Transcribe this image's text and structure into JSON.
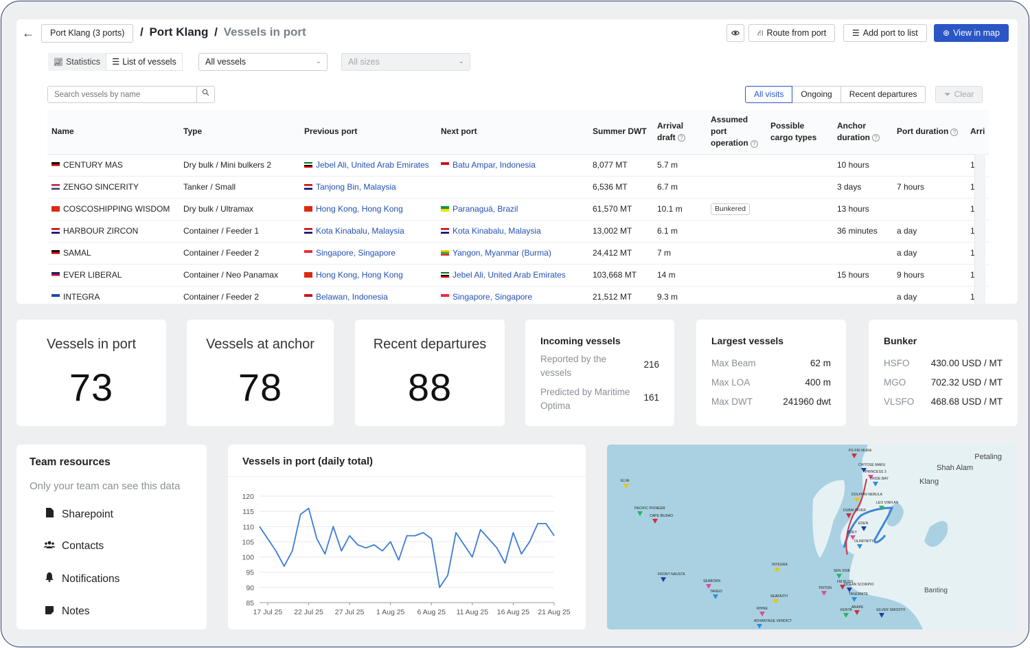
{
  "header": {
    "port_select": "Port Klang (3 ports)",
    "crumb_sep": "/",
    "port_name": "Port Klang",
    "page_name": "Vessels in port",
    "route_btn": "Route from port",
    "add_btn": "Add port to list",
    "map_btn": "View in map"
  },
  "controls": {
    "tab_stats": "Statistics",
    "tab_list": "List of vessels",
    "vessels_filter": "All vessels",
    "sizes_filter": "All sizes",
    "search_placeholder": "Search vessels by name",
    "visit_tabs": [
      "All visits",
      "Ongoing",
      "Recent departures"
    ],
    "clear": "Clear"
  },
  "table": {
    "headers": {
      "name": "Name",
      "type": "Type",
      "prev": "Previous port",
      "next": "Next port",
      "dwt": "Summer DWT",
      "arrival_draft": "Arrival draft",
      "assumed": "Assumed port operation",
      "cargo": "Possible cargo types",
      "anchor": "Anchor duration",
      "port_duration": "Port duration",
      "arrival": "Arri"
    },
    "rows": [
      {
        "name": "CENTURY MAS",
        "type": "Dry bulk / Mini bulkers 2",
        "prev": "Jebel Ali, United Arab Emirates",
        "next": "Batu Ampar, Indonesia",
        "dwt": "8,077 MT",
        "draft": "5.7 m",
        "op": "",
        "cargo": "",
        "anchor": "10 hours",
        "port": "",
        "arr": "1"
      },
      {
        "name": "ZENGO SINCERITY",
        "type": "Tanker / Small",
        "prev": "Tanjong Bin, Malaysia",
        "next": "",
        "dwt": "6,536 MT",
        "draft": "6.7 m",
        "op": "",
        "cargo": "",
        "anchor": "3 days",
        "port": "7 hours",
        "arr": "1"
      },
      {
        "name": "COSCOSHIPPING WISDOM",
        "type": "Dry bulk / Ultramax",
        "prev": "Hong Kong, Hong Kong",
        "next": "Paranaguá, Brazil",
        "dwt": "61,570 MT",
        "draft": "10.1 m",
        "op": "Bunkered",
        "cargo": "",
        "anchor": "13 hours",
        "port": "",
        "arr": "1"
      },
      {
        "name": "HARBOUR ZIRCON",
        "type": "Container / Feeder 1",
        "prev": "Kota Kinabalu, Malaysia",
        "next": "Kota Kinabalu, Malaysia",
        "dwt": "13,002 MT",
        "draft": "6.1 m",
        "op": "",
        "cargo": "",
        "anchor": "36 minutes",
        "port": "a day",
        "arr": "1"
      },
      {
        "name": "SAMAL",
        "type": "Container / Feeder 2",
        "prev": "Singapore, Singapore",
        "next": "Yangon, Myanmar (Burma)",
        "dwt": "24,412 MT",
        "draft": "7 m",
        "op": "",
        "cargo": "",
        "anchor": "",
        "port": "a day",
        "arr": "1"
      },
      {
        "name": "EVER LIBERAL",
        "type": "Container / Neo Panamax",
        "prev": "Hong Kong, Hong Kong",
        "next": "Jebel Ali, United Arab Emirates",
        "dwt": "103,668 MT",
        "draft": "14 m",
        "op": "",
        "cargo": "",
        "anchor": "15 hours",
        "port": "9 hours",
        "arr": "1"
      },
      {
        "name": "INTEGRA",
        "type": "Container / Feeder 2",
        "prev": "Belawan, Indonesia",
        "next": "Singapore, Singapore",
        "dwt": "21,512 MT",
        "draft": "9.3 m",
        "op": "",
        "cargo": "",
        "anchor": "",
        "port": "a day",
        "arr": "1"
      }
    ]
  },
  "stats": {
    "in_port": {
      "label": "Vessels in port",
      "value": "73"
    },
    "anchor": {
      "label": "Vessels at anchor",
      "value": "78"
    },
    "departures": {
      "label": "Recent departures",
      "value": "88"
    },
    "incoming": {
      "title": "Incoming vessels",
      "reported_label": "Reported by the vessels",
      "reported": "216",
      "predicted_label": "Predicted by Maritime Optima",
      "predicted": "161"
    },
    "largest": {
      "title": "Largest vessels",
      "beam_label": "Max Beam",
      "beam": "62 m",
      "loa_label": "Max LOA",
      "loa": "400 m",
      "dwt_label": "Max DWT",
      "dwt": "241960 dwt"
    },
    "bunker": {
      "title": "Bunker",
      "hsfo_label": "HSFO",
      "hsfo": "430.00 USD / MT",
      "mgo_label": "MGO",
      "mgo": "702.32 USD / MT",
      "vlsfo_label": "VLSFO",
      "vlsfo": "468.68 USD / MT"
    }
  },
  "team": {
    "title": "Team resources",
    "subtitle": "Only your team can see this data",
    "items": [
      "Sharepoint",
      "Contacts",
      "Notifications",
      "Notes"
    ]
  },
  "chart_data": {
    "type": "line",
    "title": "Vessels in port (daily total)",
    "x": [
      "16 Jul",
      "17 Jul",
      "18 Jul",
      "19 Jul",
      "20 Jul",
      "21 Jul",
      "22 Jul",
      "23 Jul",
      "24 Jul",
      "25 Jul",
      "26 Jul",
      "27 Jul",
      "28 Jul",
      "29 Jul",
      "30 Jul",
      "31 Jul",
      "1 Aug",
      "2 Aug",
      "3 Aug",
      "4 Aug",
      "5 Aug",
      "6 Aug",
      "7 Aug",
      "8 Aug",
      "9 Aug",
      "10 Aug",
      "11 Aug",
      "12 Aug",
      "13 Aug",
      "14 Aug",
      "15 Aug",
      "16 Aug",
      "17 Aug",
      "18 Aug",
      "19 Aug",
      "20 Aug",
      "21 Aug",
      "22 Aug"
    ],
    "values": [
      110,
      106,
      102,
      97,
      102,
      114,
      116,
      106,
      101,
      110,
      102,
      107,
      104,
      103,
      104,
      102,
      105,
      99,
      107,
      107,
      108,
      106,
      90,
      94,
      108,
      104,
      100,
      109,
      106,
      103,
      98,
      108,
      101,
      105,
      111,
      111,
      107
    ],
    "tick_labels": [
      "17 Jul 25",
      "22 Jul 25",
      "27 Jul 25",
      "1 Aug 25",
      "6 Aug 25",
      "11 Aug 25",
      "16 Aug 25",
      "21 Aug 25"
    ],
    "yticks": [
      85,
      90,
      95,
      100,
      105,
      110,
      115,
      120
    ],
    "ylim": [
      85,
      120
    ],
    "color": "#3a7bd5"
  },
  "map": {
    "places": [
      "Petaling",
      "Shah Alam",
      "Klang",
      "Banting"
    ],
    "vessel_labels": [
      "PS FRI MURA",
      "CHITOSE MARU",
      "PRINCESS 3",
      "TRIDE BAY",
      "DOLPHIN NEBULA",
      "LEO VINH AN",
      "DUBAI DIVER",
      "EDEN",
      "ZOEY",
      "OLINFINITY",
      "ELVA",
      "PACIFIC PIONEER",
      "CAPE BILBAO",
      "FRONT NAUSTA",
      "SEABORN",
      "TANGO",
      "INTEGRA",
      "SEN 2008",
      "FM BLISS",
      "OCEAN SCORPIO",
      "TRITON",
      "TANZANITE",
      "SEAFAITH",
      "KENTA",
      "ARAPE",
      "SILVER SMOOTH",
      "RHINE",
      "ADVANTAGE VERDICT"
    ]
  },
  "colors": {
    "accent": "#2b56c6",
    "link": "#2350b3",
    "chart_line": "#3a7bd5"
  }
}
